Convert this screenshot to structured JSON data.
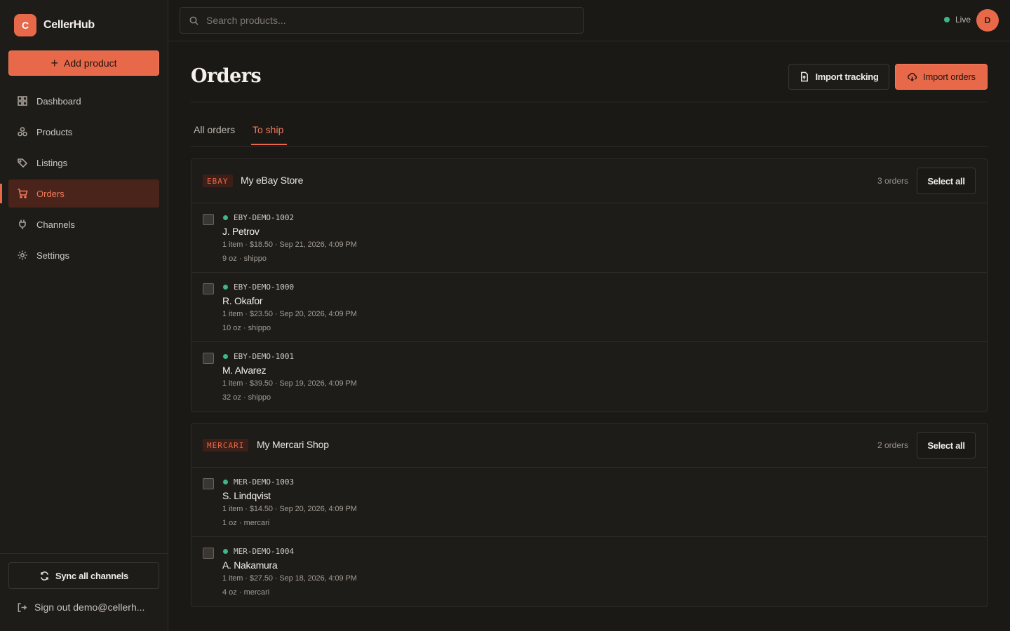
{
  "brand": {
    "logo_letter": "C",
    "name": "CellerHub"
  },
  "sidebar": {
    "add_button": "Add product",
    "items": [
      {
        "label": "Dashboard",
        "icon": "dashboard-icon"
      },
      {
        "label": "Products",
        "icon": "products-icon"
      },
      {
        "label": "Listings",
        "icon": "tag-icon"
      },
      {
        "label": "Orders",
        "icon": "cart-icon",
        "active": true
      },
      {
        "label": "Channels",
        "icon": "plug-icon"
      },
      {
        "label": "Settings",
        "icon": "gear-icon"
      }
    ],
    "sync_button": "Sync all channels",
    "signout": "Sign out demo@cellerh..."
  },
  "topbar": {
    "search_placeholder": "Search products...",
    "status": "Live",
    "avatar_letter": "D"
  },
  "page": {
    "title": "Orders",
    "import_tracking": "Import tracking",
    "import_orders": "Import orders",
    "tabs": [
      {
        "label": "All orders",
        "active": false
      },
      {
        "label": "To ship",
        "active": true
      }
    ]
  },
  "groups": [
    {
      "channel": "EBAY",
      "store": "My eBay Store",
      "count": "3 orders",
      "select_all": "Select all",
      "orders": [
        {
          "id": "EBY-DEMO-1002",
          "customer": "J. Petrov",
          "meta": "1 item · $18.50 · Sep 21, 2026, 4:09 PM",
          "ship": "9 oz · shippo"
        },
        {
          "id": "EBY-DEMO-1000",
          "customer": "R. Okafor",
          "meta": "1 item · $23.50 · Sep 20, 2026, 4:09 PM",
          "ship": "10 oz · shippo"
        },
        {
          "id": "EBY-DEMO-1001",
          "customer": "M. Alvarez",
          "meta": "1 item · $39.50 · Sep 19, 2026, 4:09 PM",
          "ship": "32 oz · shippo"
        }
      ]
    },
    {
      "channel": "MERCARI",
      "store": "My Mercari Shop",
      "count": "2 orders",
      "select_all": "Select all",
      "orders": [
        {
          "id": "MER-DEMO-1003",
          "customer": "S. Lindqvist",
          "meta": "1 item · $14.50 · Sep 20, 2026, 4:09 PM",
          "ship": "1 oz · mercari"
        },
        {
          "id": "MER-DEMO-1004",
          "customer": "A. Nakamura",
          "meta": "1 item · $27.50 · Sep 18, 2026, 4:09 PM",
          "ship": "4 oz · mercari"
        }
      ]
    }
  ],
  "colors": {
    "accent": "#e8694a",
    "background": "#1b1916",
    "status_green": "#3fb58b"
  }
}
